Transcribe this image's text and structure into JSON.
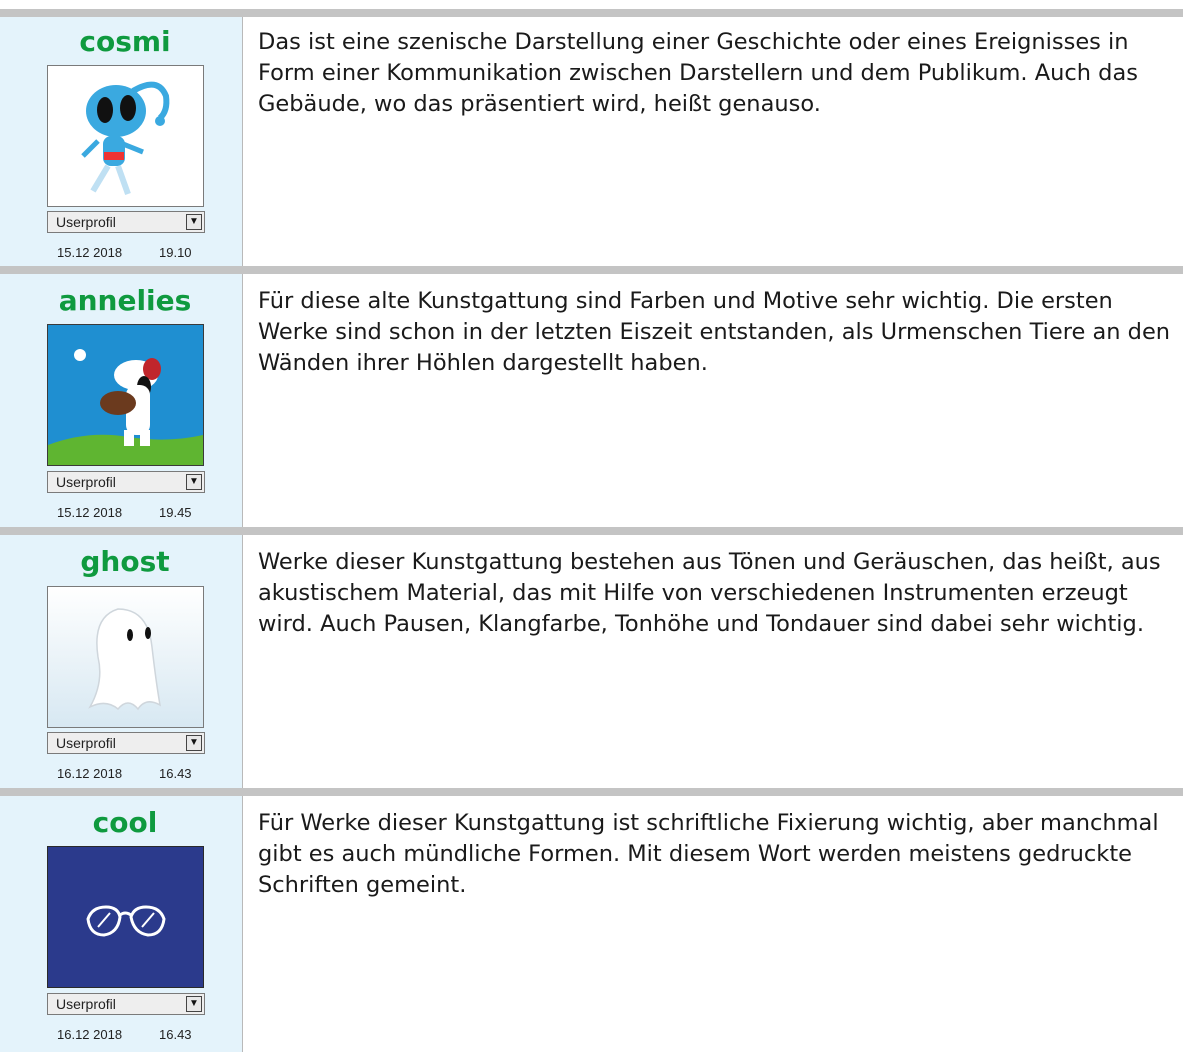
{
  "posts": [
    {
      "username": "cosmi",
      "profile_label": "Userprofil",
      "date": "15.12 2018",
      "time": "19.10",
      "avatar": "cartoon-alien-avatar",
      "text": "Das ist eine szenische Darstellung einer Geschichte oder eines Ereignisses in Form einer Kommunikation zwischen Darstellern und dem Publikum. Auch das Gebäude, wo das präsentiert wird, heißt genauso."
    },
    {
      "username": "annelies",
      "profile_label": "Userprofil",
      "date": "15.12 2018",
      "time": "19.45",
      "avatar": "baseball-dog-avatar",
      "text": "Für diese alte Kunstgattung sind Farben und Motive sehr wichtig. Die ersten Werke sind schon in der letzten Eiszeit entstanden, als Urmenschen Tiere an den Wänden ihrer Höhlen dargestellt haben."
    },
    {
      "username": "ghost",
      "profile_label": "Userprofil",
      "date": "16.12 2018",
      "time": "16.43",
      "avatar": "ghost-avatar",
      "text": "Werke dieser Kunstgattung bestehen aus Tönen und Geräuschen, das heißt, aus akustischem Material, das mit Hilfe von verschiedenen Instrumenten erzeugt wird. Auch Pausen, Klangfarbe, Tonhöhe und Tondauer sind dabei sehr wichtig."
    },
    {
      "username": "cool",
      "profile_label": "Userprofil",
      "date": "16.12 2018",
      "time": "16.43",
      "avatar": "sunglasses-avatar",
      "text": "Für Werke dieser Kunstgattung ist schriftliche Fixierung wichtig, aber manchmal gibt es auch mündliche Formen. Mit diesem Wort werden meistens gedruckte Schriften gemeint."
    }
  ],
  "colors": {
    "username": "#0f9a3f",
    "user_column_bg": "#e4f3fb",
    "separator": "#c4c4c4"
  }
}
